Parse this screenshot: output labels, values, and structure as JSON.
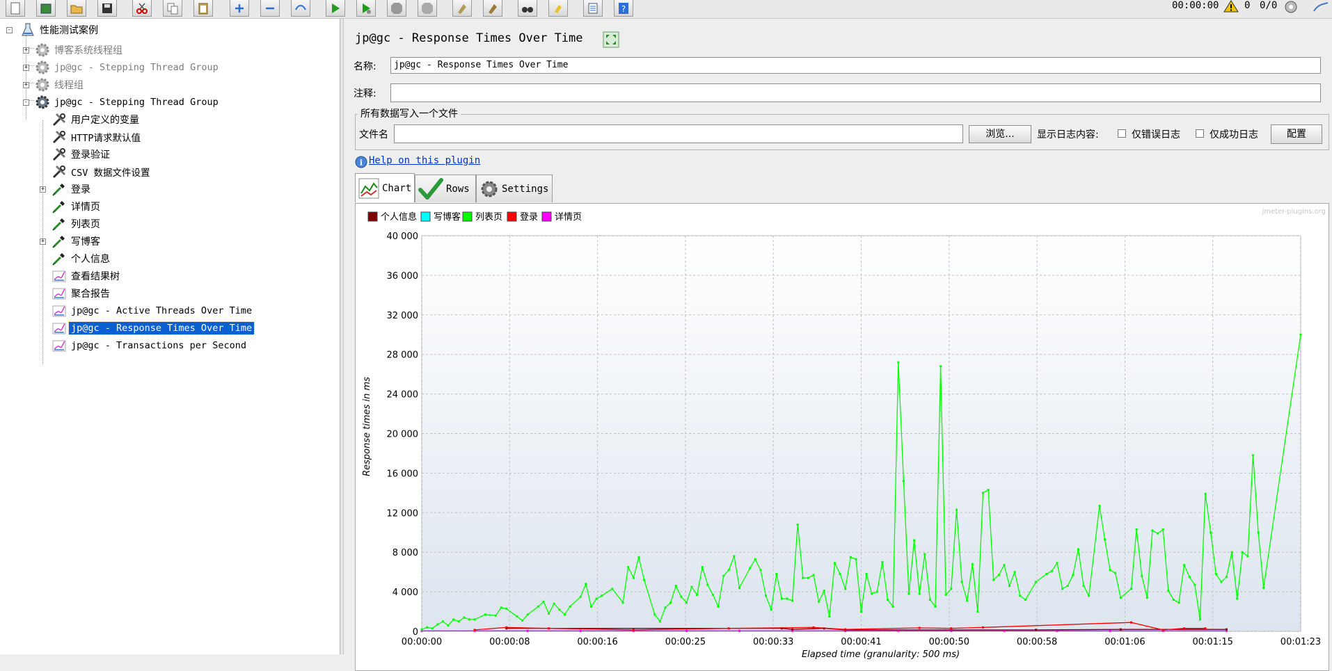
{
  "toolbar": {
    "timer": "00:00:00",
    "warning_count": "0",
    "thread_ratio": "0/0"
  },
  "tree": {
    "root": "性能测试案例",
    "items": [
      {
        "label": "博客系统线程组",
        "disabled": true
      },
      {
        "label": "jp@gc - Stepping Thread Group",
        "disabled": true
      },
      {
        "label": "线程组",
        "disabled": true
      },
      {
        "label": "jp@gc - Stepping Thread Group",
        "disabled": false
      },
      {
        "label": "用户定义的变量"
      },
      {
        "label": "HTTP请求默认值"
      },
      {
        "label": "登录验证"
      },
      {
        "label": "CSV 数据文件设置"
      },
      {
        "label": "登录"
      },
      {
        "label": "详情页"
      },
      {
        "label": "列表页"
      },
      {
        "label": "写博客"
      },
      {
        "label": "个人信息"
      },
      {
        "label": "查看结果树"
      },
      {
        "label": "聚合报告"
      },
      {
        "label": "jp@gc - Active Threads Over Time"
      },
      {
        "label": "jp@gc - Response Times Over Time",
        "selected": true
      },
      {
        "label": "jp@gc - Transactions per Second"
      }
    ]
  },
  "panel": {
    "title": "jp@gc - Response Times Over Time",
    "name_label": "名称:",
    "name_value": "jp@gc - Response Times Over Time",
    "comment_label": "注释:",
    "comment_value": "",
    "file_group_title": "所有数据写入一个文件",
    "file_label": "文件名",
    "file_value": "",
    "browse_label": "浏览...",
    "log_label": "显示日志内容:",
    "errors_only_label": "仅错误日志",
    "success_only_label": "仅成功日志",
    "configure_label": "配置",
    "help_link": "Help on this plugin",
    "tabs": [
      {
        "label": "Chart",
        "active": true
      },
      {
        "label": "Rows",
        "active": false
      },
      {
        "label": "Settings",
        "active": false
      }
    ],
    "watermark": "jmeter-plugins.org"
  },
  "chart_data": {
    "type": "line",
    "title": "",
    "xlabel": "Elapsed time (granularity: 500 ms)",
    "ylabel": "Response times in ms",
    "ylim": [
      0,
      40000
    ],
    "yticks": [
      "0",
      "4 000",
      "8 000",
      "12 000",
      "16 000",
      "20 000",
      "24 000",
      "28 000",
      "32 000",
      "36 000",
      "40 000"
    ],
    "xticks": [
      "00:00:00",
      "00:00:08",
      "00:00:16",
      "00:00:25",
      "00:00:33",
      "00:00:41",
      "00:00:50",
      "00:00:58",
      "00:01:06",
      "00:01:15",
      "00:01:23"
    ],
    "xlim_seconds": [
      0,
      83
    ],
    "grid": true,
    "legend_position": "top-left",
    "series": [
      {
        "name": "个人信息",
        "color": "#800000",
        "points": [
          [
            8,
            300
          ],
          [
            34,
            300
          ],
          [
            35,
            200
          ],
          [
            38,
            300
          ],
          [
            40,
            150
          ],
          [
            58,
            150
          ],
          [
            66,
            200
          ],
          [
            76,
            200
          ]
        ]
      },
      {
        "name": "写博客",
        "color": "#00ffff",
        "points": [
          [
            0,
            50
          ],
          [
            10,
            50
          ],
          [
            20,
            50
          ],
          [
            30,
            50
          ],
          [
            40,
            50
          ],
          [
            50,
            50
          ],
          [
            60,
            50
          ],
          [
            70,
            50
          ],
          [
            76,
            50
          ]
        ]
      },
      {
        "name": "列表页",
        "color": "#00ff00",
        "points": [
          [
            0,
            200
          ],
          [
            0.5,
            400
          ],
          [
            1,
            300
          ],
          [
            1.5,
            700
          ],
          [
            2,
            1000
          ],
          [
            2.5,
            600
          ],
          [
            3,
            1200
          ],
          [
            3.5,
            1000
          ],
          [
            4,
            1400
          ],
          [
            4.5,
            1200
          ],
          [
            5,
            1200
          ],
          [
            6,
            1700
          ],
          [
            7,
            1600
          ],
          [
            7.5,
            2400
          ],
          [
            8,
            2300
          ],
          [
            9,
            1500
          ],
          [
            9.5,
            1100
          ],
          [
            10,
            1700
          ],
          [
            11,
            2500
          ],
          [
            11.5,
            3000
          ],
          [
            12,
            1800
          ],
          [
            12.5,
            2800
          ],
          [
            13,
            2200
          ],
          [
            13.5,
            1700
          ],
          [
            14,
            2500
          ],
          [
            15,
            3500
          ],
          [
            15.5,
            4800
          ],
          [
            16,
            2500
          ],
          [
            16.5,
            3300
          ],
          [
            17,
            3600
          ],
          [
            18,
            4300
          ],
          [
            19,
            2900
          ],
          [
            19.5,
            6500
          ],
          [
            20,
            5400
          ],
          [
            20.5,
            7500
          ],
          [
            21,
            5200
          ],
          [
            22,
            1700
          ],
          [
            22.5,
            1000
          ],
          [
            23,
            2400
          ],
          [
            23.5,
            2900
          ],
          [
            24,
            4600
          ],
          [
            24.5,
            3500
          ],
          [
            25,
            2900
          ],
          [
            25.5,
            4500
          ],
          [
            26,
            3700
          ],
          [
            26.5,
            6500
          ],
          [
            27,
            4700
          ],
          [
            27.5,
            3700
          ],
          [
            28,
            2500
          ],
          [
            28.5,
            5600
          ],
          [
            29,
            6200
          ],
          [
            29.5,
            7600
          ],
          [
            30,
            4400
          ],
          [
            31,
            6400
          ],
          [
            31.5,
            7300
          ],
          [
            32,
            6200
          ],
          [
            32.5,
            3600
          ],
          [
            33,
            2200
          ],
          [
            33.5,
            5800
          ],
          [
            34,
            3300
          ],
          [
            34.5,
            3300
          ],
          [
            35,
            3100
          ],
          [
            35.5,
            10800
          ],
          [
            36,
            5400
          ],
          [
            36.5,
            5400
          ],
          [
            37,
            5700
          ],
          [
            37.5,
            3000
          ],
          [
            38,
            4100
          ],
          [
            38.5,
            1500
          ],
          [
            39,
            6900
          ],
          [
            39.5,
            5800
          ],
          [
            40,
            4300
          ],
          [
            40.5,
            7500
          ],
          [
            41,
            7300
          ],
          [
            41.5,
            2000
          ],
          [
            42,
            5800
          ],
          [
            42.5,
            3800
          ],
          [
            43,
            4000
          ],
          [
            43.5,
            7000
          ],
          [
            44,
            3200
          ],
          [
            44.5,
            2500
          ],
          [
            45,
            27200
          ],
          [
            45.5,
            15200
          ],
          [
            46,
            3800
          ],
          [
            46.5,
            9200
          ],
          [
            47,
            3800
          ],
          [
            47.5,
            7800
          ],
          [
            48,
            3200
          ],
          [
            48.5,
            2500
          ],
          [
            49,
            26800
          ],
          [
            49.5,
            3700
          ],
          [
            50,
            4300
          ],
          [
            50.5,
            12300
          ],
          [
            51,
            5000
          ],
          [
            51.5,
            3100
          ],
          [
            52,
            6800
          ],
          [
            52.5,
            2000
          ],
          [
            53,
            14000
          ],
          [
            53.5,
            14300
          ],
          [
            54,
            5200
          ],
          [
            54.5,
            5700
          ],
          [
            55,
            6700
          ],
          [
            55.5,
            4600
          ],
          [
            56,
            6000
          ],
          [
            56.5,
            3600
          ],
          [
            57,
            3200
          ],
          [
            58,
            5000
          ],
          [
            59,
            5800
          ],
          [
            59.5,
            6100
          ],
          [
            60,
            6900
          ],
          [
            60.5,
            4300
          ],
          [
            61,
            4600
          ],
          [
            61.5,
            5700
          ],
          [
            62,
            8300
          ],
          [
            62.5,
            4600
          ],
          [
            63,
            3600
          ],
          [
            64,
            12700
          ],
          [
            64.5,
            9300
          ],
          [
            65,
            6200
          ],
          [
            65.5,
            5900
          ],
          [
            66,
            3400
          ],
          [
            67,
            4300
          ],
          [
            67.5,
            10300
          ],
          [
            68,
            5600
          ],
          [
            68.5,
            3400
          ],
          [
            69,
            10200
          ],
          [
            69.5,
            9900
          ],
          [
            70,
            10300
          ],
          [
            70.5,
            4100
          ],
          [
            71,
            3200
          ],
          [
            71.5,
            2900
          ],
          [
            72,
            6700
          ],
          [
            72.5,
            5500
          ],
          [
            73,
            4700
          ],
          [
            73.5,
            1200
          ],
          [
            74,
            13900
          ],
          [
            74.5,
            10000
          ],
          [
            75,
            5800
          ],
          [
            75.5,
            5000
          ],
          [
            76,
            5500
          ],
          [
            76.5,
            8000
          ],
          [
            77,
            3300
          ],
          [
            77.5,
            8000
          ],
          [
            78,
            7600
          ],
          [
            78.5,
            17800
          ],
          [
            79,
            10000
          ],
          [
            79.5,
            4400
          ],
          [
            83,
            30000
          ]
        ]
      },
      {
        "name": "登录",
        "color": "#ff0000",
        "points": [
          [
            5,
            150
          ],
          [
            8,
            400
          ],
          [
            12,
            300
          ],
          [
            20,
            150
          ],
          [
            29,
            300
          ],
          [
            37,
            400
          ],
          [
            40,
            200
          ],
          [
            47,
            350
          ],
          [
            50,
            300
          ],
          [
            53,
            400
          ],
          [
            67,
            900
          ],
          [
            70,
            150
          ],
          [
            72,
            300
          ],
          [
            74,
            300
          ]
        ]
      },
      {
        "name": "详情页",
        "color": "#ff00ff",
        "points": [
          [
            0,
            50
          ],
          [
            5,
            50
          ],
          [
            10,
            50
          ],
          [
            15,
            50
          ],
          [
            20,
            50
          ],
          [
            25,
            50
          ],
          [
            30,
            50
          ],
          [
            35,
            50
          ],
          [
            40,
            50
          ],
          [
            45,
            50
          ],
          [
            50,
            50
          ],
          [
            55,
            50
          ],
          [
            60,
            50
          ],
          [
            65,
            50
          ],
          [
            70,
            50
          ],
          [
            76,
            50
          ]
        ]
      }
    ]
  }
}
